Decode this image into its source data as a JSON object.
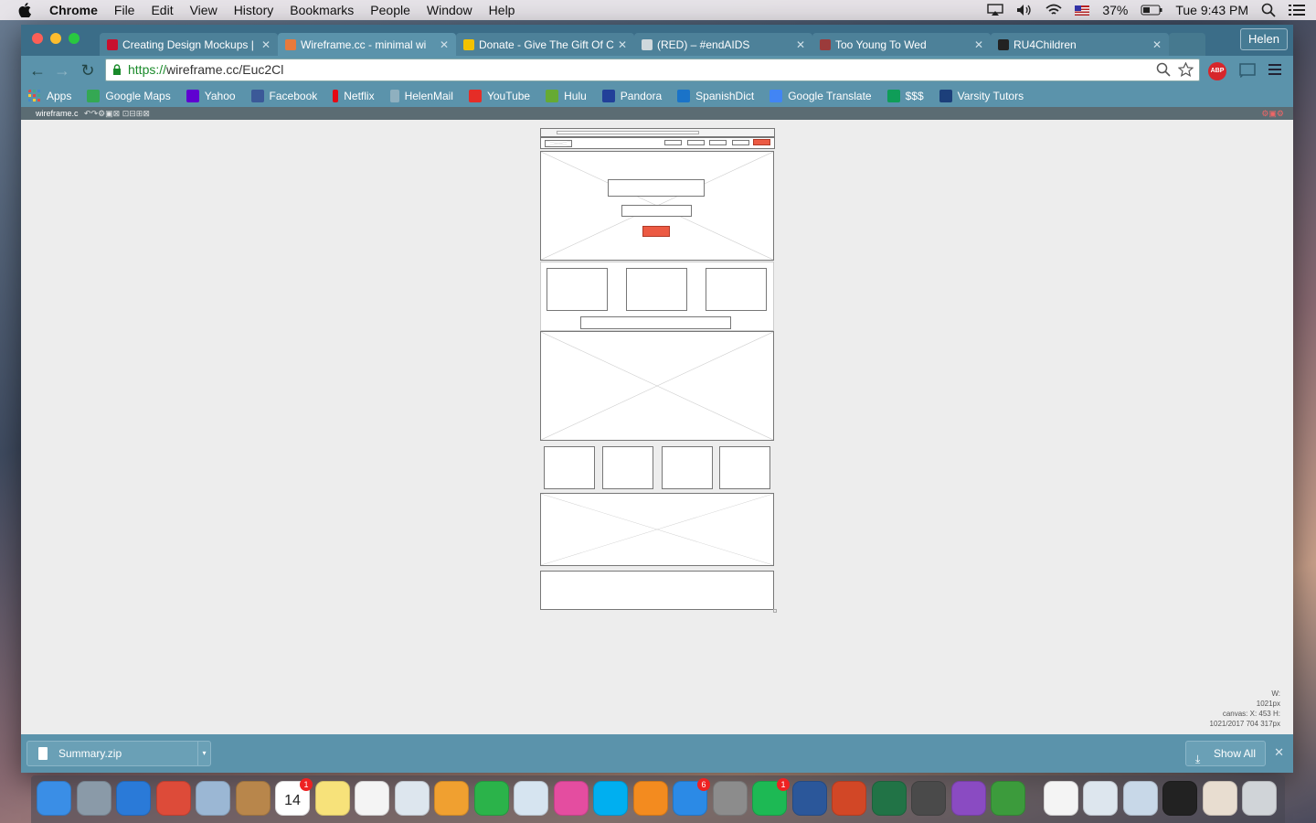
{
  "menubar": {
    "app_name": "Chrome",
    "menus": [
      "File",
      "Edit",
      "View",
      "History",
      "Bookmarks",
      "People",
      "Window",
      "Help"
    ],
    "battery": "37%",
    "clock": "Tue 9:43 PM"
  },
  "tabs": [
    {
      "title": "Creating Design Mockups |",
      "favicon_color": "#c8102e",
      "active": false
    },
    {
      "title": "Wireframe.cc - minimal wi",
      "favicon_color": "#e87a3c",
      "active": true
    },
    {
      "title": "Donate - Give The Gift Of C",
      "favicon_color": "#f2c200",
      "active": false
    },
    {
      "title": "(RED) – #endAIDS",
      "favicon_color": "#cfd8dc",
      "active": false
    },
    {
      "title": "Too Young To Wed",
      "favicon_color": "#9b3b3b",
      "active": false
    },
    {
      "title": "RU4Children",
      "favicon_color": "#222222",
      "active": false
    }
  ],
  "profile_name": "Helen",
  "address": {
    "scheme": "https://",
    "rest": "wireframe.cc/Euc2Cl"
  },
  "abp_label": "ABP",
  "bookmarks": [
    {
      "label": "Apps",
      "icon_color": "#e04848"
    },
    {
      "label": "Google Maps",
      "icon_color": "#34a853"
    },
    {
      "label": "Yahoo",
      "icon_color": "#5f01d1"
    },
    {
      "label": "Facebook",
      "icon_color": "#3b5998"
    },
    {
      "label": "Netflix",
      "icon_color": "#e50914"
    },
    {
      "label": "HelenMail",
      "icon_color": "#8fb0bf"
    },
    {
      "label": "YouTube",
      "icon_color": "#e52d27"
    },
    {
      "label": "Hulu",
      "icon_color": "#66aa33"
    },
    {
      "label": "Pandora",
      "icon_color": "#224099"
    },
    {
      "label": "SpanishDict",
      "icon_color": "#1a73c8"
    },
    {
      "label": "Google Translate",
      "icon_color": "#4285f4"
    },
    {
      "label": "$$$",
      "icon_color": "#0f9d58"
    },
    {
      "label": "Varsity Tutors",
      "icon_color": "#1c3f7a"
    }
  ],
  "app_strip_label": "wireframe.c",
  "wireframe": {
    "accent": "#ec5a43",
    "nav_links": 4
  },
  "canvas_info": {
    "w_label": "W:",
    "w_value": "1021px",
    "h_label": "H:",
    "h_value": "317px",
    "canvas_label": "canvas:",
    "canvas_value": "1021/2017",
    "x_label": "X: 453",
    "y_value": "704"
  },
  "downloads": {
    "file": "Summary.zip",
    "show_all": "Show All"
  },
  "dock": [
    {
      "name": "finder",
      "color": "#3a8ee6"
    },
    {
      "name": "launchpad",
      "color": "#8a9aa8"
    },
    {
      "name": "safari",
      "color": "#2a7ad8"
    },
    {
      "name": "chrome",
      "color": "#dd4b39"
    },
    {
      "name": "preview",
      "color": "#9bb7d4"
    },
    {
      "name": "contacts",
      "color": "#b8864b"
    },
    {
      "name": "calendar",
      "color": "#ffffff",
      "badge": "1",
      "text": "14"
    },
    {
      "name": "notes",
      "color": "#f7e27a"
    },
    {
      "name": "reminders",
      "color": "#f4f4f4"
    },
    {
      "name": "preview-2",
      "color": "#dde6ee"
    },
    {
      "name": "photos",
      "color": "#f0a030"
    },
    {
      "name": "facetime",
      "color": "#2bb34a"
    },
    {
      "name": "iphoto",
      "color": "#d6e4f0"
    },
    {
      "name": "itunes",
      "color": "#e44da0"
    },
    {
      "name": "skype",
      "color": "#00aff0"
    },
    {
      "name": "ibooks",
      "color": "#f38b1f"
    },
    {
      "name": "app-store",
      "color": "#2b8ae6",
      "badge": "6"
    },
    {
      "name": "system-preferences",
      "color": "#8c8c8c"
    },
    {
      "name": "spotify",
      "color": "#1db954",
      "badge": "1"
    },
    {
      "name": "word",
      "color": "#2b579a"
    },
    {
      "name": "powerpoint",
      "color": "#d24726"
    },
    {
      "name": "excel",
      "color": "#217346"
    },
    {
      "name": "sublime",
      "color": "#4a4a4a"
    },
    {
      "name": "github",
      "color": "#8a4bc2"
    },
    {
      "name": "time-machine",
      "color": "#3c9b3c"
    },
    {
      "name": "document",
      "color": "#f4f4f4"
    },
    {
      "name": "stack-1",
      "color": "#dde6ee"
    },
    {
      "name": "stack-2",
      "color": "#c8d8e8"
    },
    {
      "name": "terminal",
      "color": "#222222"
    },
    {
      "name": "stack-3",
      "color": "#e8ddd0"
    },
    {
      "name": "trash",
      "color": "#d0d4d8"
    }
  ]
}
